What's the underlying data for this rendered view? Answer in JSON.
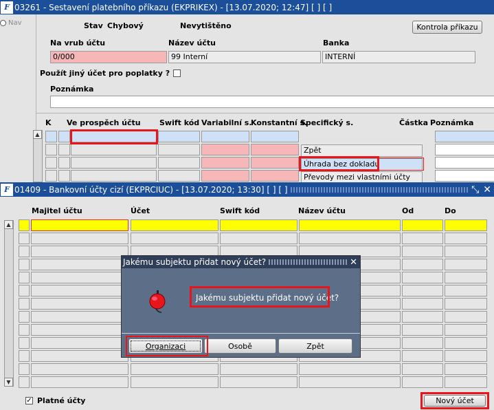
{
  "top_window": {
    "title": "03261 - Sestavení platebního příkazu (EKPRIKEX) - [13.07.2020; 12:47]  [ ]  [ ]",
    "nav_label": "Nav",
    "stav_label": "Stav",
    "stav_value": "Chybový",
    "print_status": "Nevytištěno",
    "kontrola_button": "Kontrola příkazu",
    "na_vrub_label": "Na vrub účtu",
    "na_vrub_value": "0/000",
    "nazev_uctu_label": "Název účtu",
    "nazev_uctu_value": "99 Interní",
    "banka_label": "Banka",
    "banka_value": "INTERNÍ",
    "pouzit_ucet_label": "Použít jiný účet pro poplatky ?",
    "poznamka_label": "Poznámka",
    "columns": [
      "K",
      "Ve prospěch účtu",
      "Swift kód",
      "Variabilní s.",
      "Konstantní s.",
      "Specifický s.",
      "Částka",
      "Poznámka"
    ],
    "menu_items": [
      "Zpět",
      "Úhrada bez dokladu",
      "Převody mezi vlastními účty"
    ]
  },
  "second_window": {
    "title": "01409 - Bankovní účty cizí (EKPRCIUC) - [13.07.2020; 13:30]  [ ]  [ ]",
    "columns": [
      "Majitel účtu",
      "Účet",
      "Swift kód",
      "Název účtu",
      "Od",
      "Do"
    ],
    "platne_label": "Platné účty",
    "novy_ucet_button": "Nový účet"
  },
  "dialog": {
    "title": "Jakému subjektu přidat nový účet?",
    "message": "Jakému subjektu přidat nový účet?",
    "buttons": [
      "Organizaci",
      "Osobě",
      "Zpět"
    ],
    "colors": {
      "background": "#5d6e89",
      "highlight": "#e8151b"
    }
  }
}
